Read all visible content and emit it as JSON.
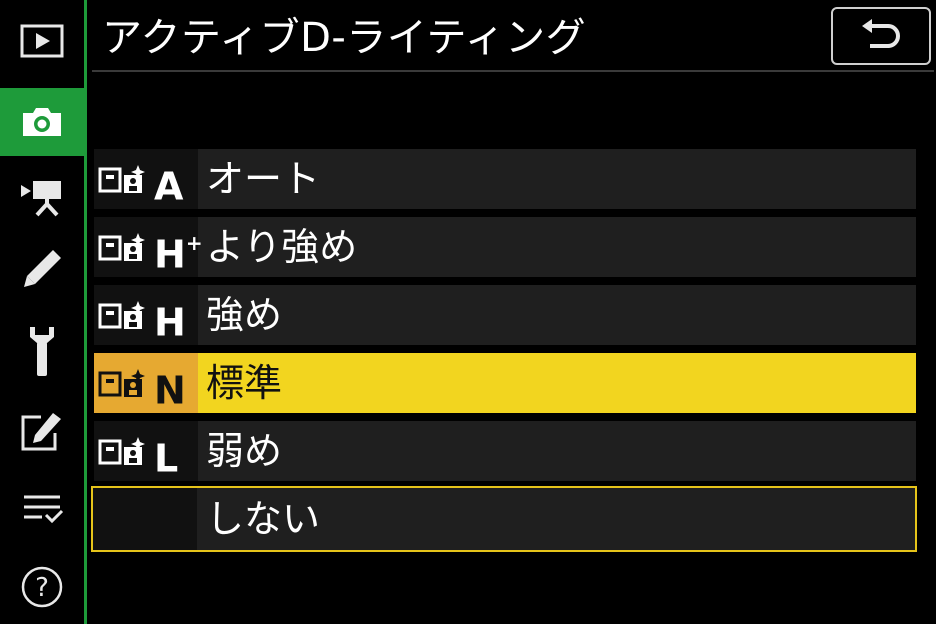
{
  "header": {
    "title": "アクティブD-ライティング",
    "back_icon": "return-arrow-icon"
  },
  "sidebar": {
    "active": "photo-shooting-menu",
    "items": [
      {
        "name": "playback-menu-icon"
      },
      {
        "name": "photo-shooting-menu-icon"
      },
      {
        "name": "movie-recording-menu-icon"
      },
      {
        "name": "custom-settings-menu-icon"
      },
      {
        "name": "setup-menu-icon"
      },
      {
        "name": "retouch-menu-icon"
      },
      {
        "name": "my-menu-icon"
      },
      {
        "name": "help-icon",
        "label": "?"
      }
    ]
  },
  "options": [
    {
      "letter": "A",
      "sup": "",
      "label": "オート"
    },
    {
      "letter": "H",
      "sup": "+",
      "label": "より強め"
    },
    {
      "letter": "H",
      "sup": "",
      "label": "強め"
    },
    {
      "letter": "N",
      "sup": "",
      "label": "標準",
      "state": "selected"
    },
    {
      "letter": "L",
      "sup": "",
      "label": "弱め"
    },
    {
      "letter": "",
      "sup": "",
      "label": "しない",
      "state": "outlined"
    }
  ],
  "colors": {
    "accent_green": "#1e9b3a",
    "selected_yellow": "#f2d51f",
    "selected_icon_bg": "#e6a931"
  }
}
